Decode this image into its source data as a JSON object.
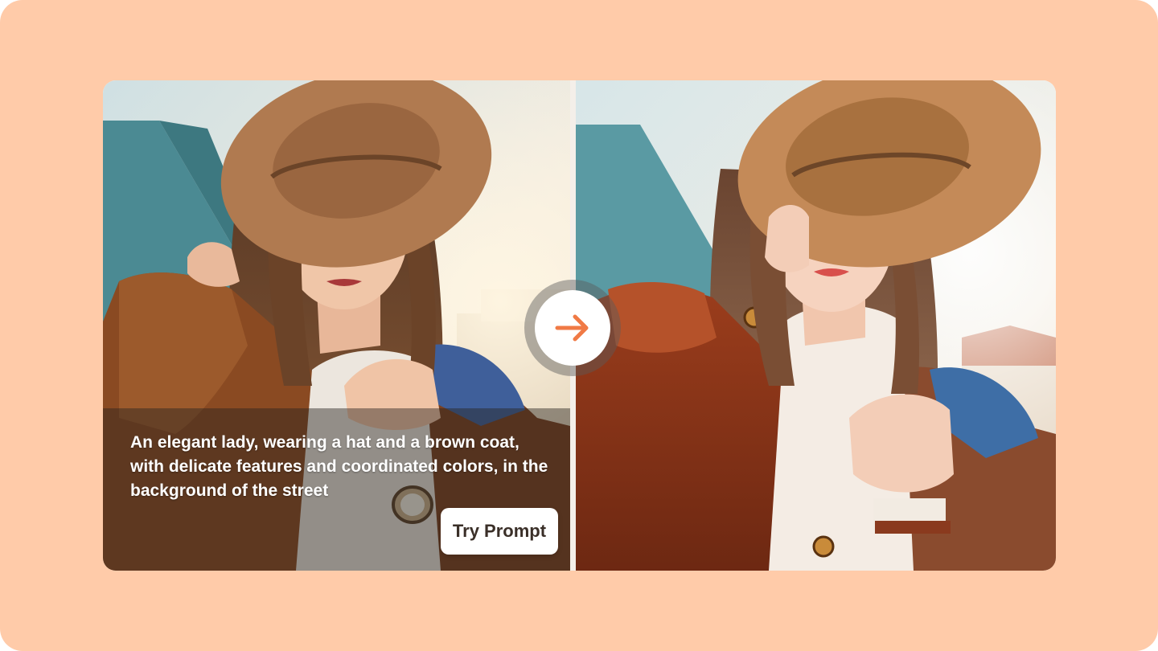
{
  "caption": {
    "prompt_text": "An elegant lady, wearing a hat and a brown coat, with delicate features and coordinated colors, in the background of the street",
    "button_label": "Try Prompt"
  },
  "icons": {
    "transform": "arrow-right-icon"
  },
  "colors": {
    "page_background": "#ffcba9",
    "arrow_accent": "#f07a45",
    "button_background": "#ffffff"
  }
}
